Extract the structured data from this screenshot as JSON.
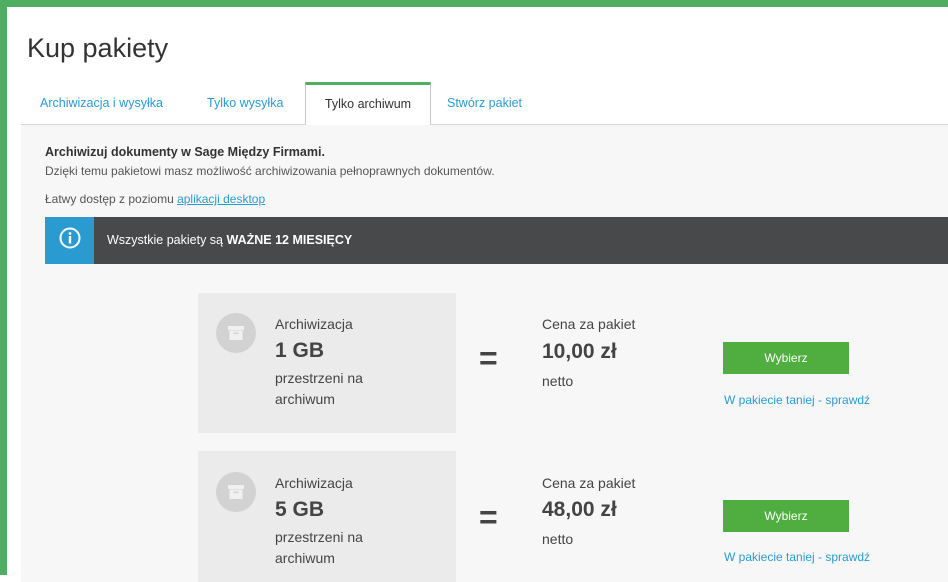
{
  "page": {
    "title": "Kup pakiety"
  },
  "tabs": [
    {
      "label": "Archiwizacja i wysyłka",
      "active": false
    },
    {
      "label": "Tylko wysyłka",
      "active": false
    },
    {
      "label": "Tylko archiwum",
      "active": true
    },
    {
      "label": "Stwórz pakiet",
      "active": false
    }
  ],
  "intro": {
    "heading": "Archiwizuj dokumenty w Sage Między Firmami.",
    "text": "Dzięki temu pakietowi masz możliwość archiwizowania pełnoprawnych dokumentów.",
    "link_prefix": "Łatwy dostęp z poziomu ",
    "link_text": "aplikacji desktop"
  },
  "info_bar": {
    "icon": "info-icon",
    "text_prefix": "Wszystkie pakiety są ",
    "text_bold": "WAŻNE 12 MIESIĘCY"
  },
  "packages": [
    {
      "icon": "archive-box-icon",
      "name": "Archiwizacja",
      "size": "1 GB",
      "desc_line1": "przestrzeni na",
      "desc_line2": "archiwum",
      "equals": "=",
      "price_label": "Cena za pakiet",
      "price": "10,00 zł",
      "price_unit": "netto",
      "button_label": "Wybierz",
      "link_label": "W pakiecie taniej - sprawdź"
    },
    {
      "icon": "archive-box-icon",
      "name": "Archiwizacja",
      "size": "5 GB",
      "desc_line1": "przestrzeni na",
      "desc_line2": "archiwum",
      "equals": "=",
      "price_label": "Cena za pakiet",
      "price": "48,00 zł",
      "price_unit": "netto",
      "button_label": "Wybierz",
      "link_label": "W pakiecie taniej - sprawdź"
    }
  ],
  "colors": {
    "accent_green": "#4fae62",
    "button_green": "#4fae3f",
    "link_blue": "#2a9bd0",
    "info_bar_bg": "#47494b"
  }
}
